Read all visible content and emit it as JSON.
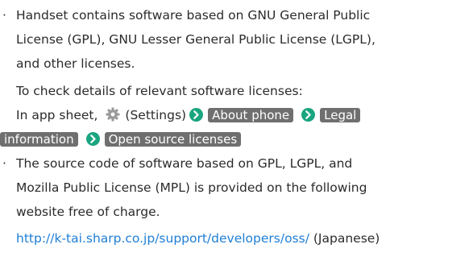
{
  "bullet_mark": "·",
  "colors": {
    "text": "#2b2b2b",
    "key_bg": "#6f6f6f",
    "arrow": "#1aa57f",
    "link": "#1f7fd6"
  },
  "para1": {
    "line1": "Handset contains software based on GNU General Public",
    "line2": "License (GPL), GNU Lesser General Public License (LGPL),",
    "line3": "and other licenses.",
    "line4": "To check details of relevant software licenses:",
    "line5_prefix": "In app sheet,",
    "settings_label": "(Settings)",
    "key_about_phone": "About phone",
    "key_legal_part1": "Legal",
    "key_legal_part2": "information",
    "key_open_source": "Open source licenses"
  },
  "para2": {
    "line1": "The source code of software based on GPL, LGPL, and",
    "line2": "Mozilla Public License (MPL) is provided on the following",
    "line3": "website free of charge.",
    "url": "http://k-tai.sharp.co.jp/support/developers/oss/",
    "url_suffix": "(Japanese)"
  }
}
